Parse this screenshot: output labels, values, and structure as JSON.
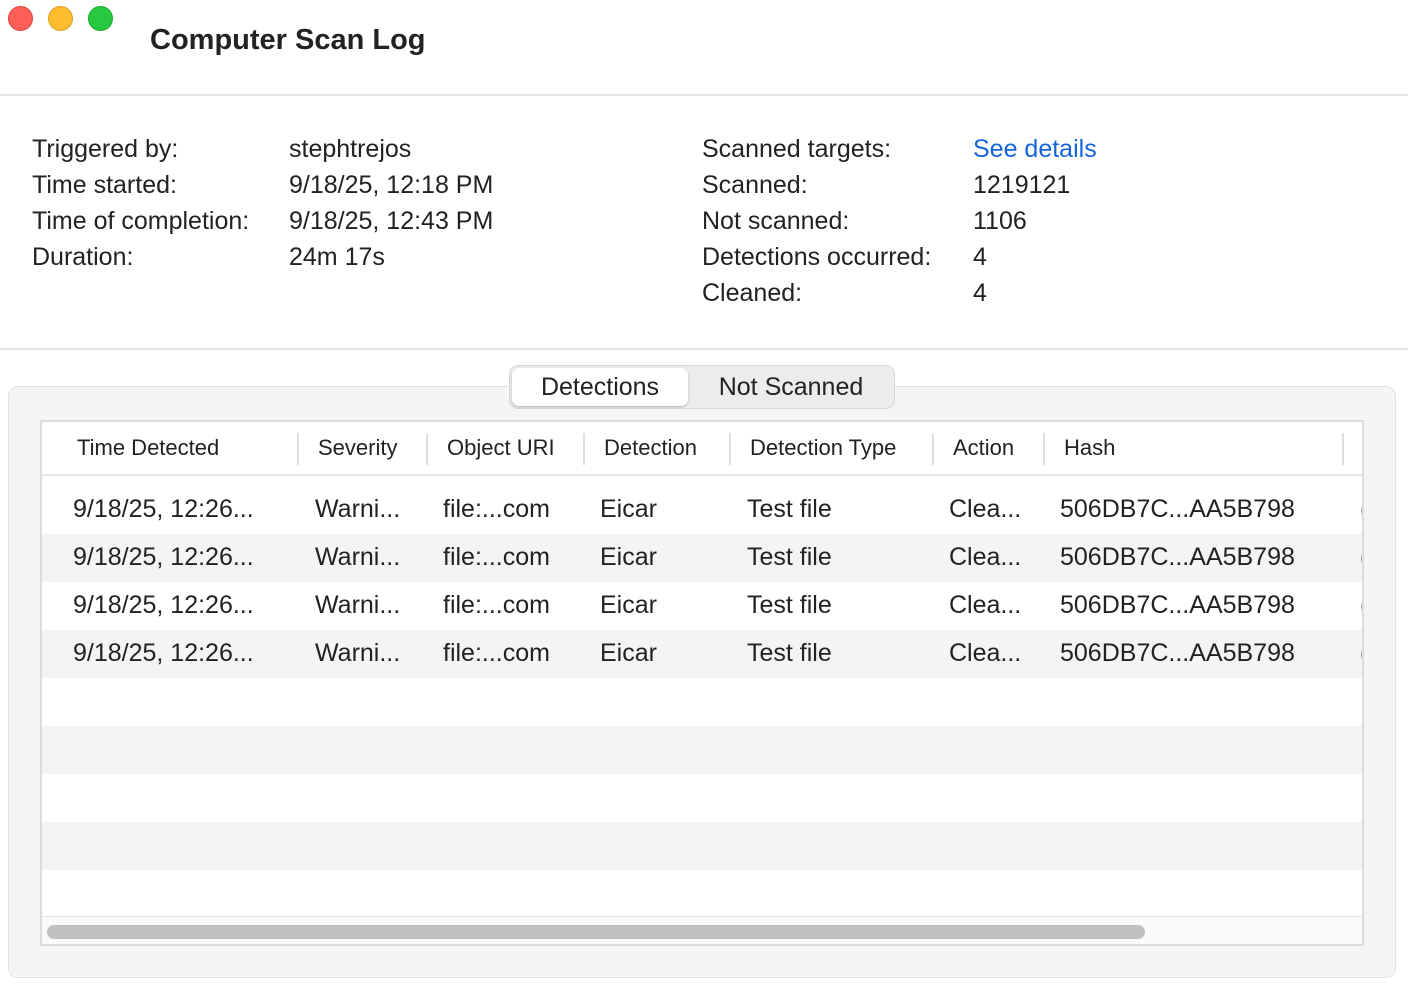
{
  "window": {
    "title": "Computer Scan Log"
  },
  "summary": {
    "left": [
      {
        "label": "Triggered by:",
        "value": "stephtrejos"
      },
      {
        "label": "Time started:",
        "value": "9/18/25, 12:18 PM"
      },
      {
        "label": "Time of completion:",
        "value": "9/18/25, 12:43 PM"
      },
      {
        "label": "Duration:",
        "value": "24m 17s"
      }
    ],
    "right": [
      {
        "label": "Scanned targets:",
        "value": "See details"
      },
      {
        "label": "Scanned:",
        "value": "1219121"
      },
      {
        "label": "Not scanned:",
        "value": "1106"
      },
      {
        "label": "Detections occurred:",
        "value": "4"
      },
      {
        "label": "Cleaned:",
        "value": "4"
      }
    ],
    "link_color": "#1565d8"
  },
  "tabs": [
    {
      "label": "Detections",
      "selected": true
    },
    {
      "label": "Not Scanned",
      "selected": false
    }
  ],
  "table": {
    "columns": [
      "Time Detected",
      "Severity",
      "Object URI",
      "Detection",
      "Detection Type",
      "Action",
      "Hash"
    ],
    "rows": [
      [
        "9/18/25, 12:26...",
        "Warni...",
        "file:...com",
        "Eicar",
        "Test file",
        "Clea...",
        "506DB7C...AA5B798"
      ],
      [
        "9/18/25, 12:26...",
        "Warni...",
        "file:...com",
        "Eicar",
        "Test file",
        "Clea...",
        "506DB7C...AA5B798"
      ],
      [
        "9/18/25, 12:26...",
        "Warni...",
        "file:...com",
        "Eicar",
        "Test file",
        "Clea...",
        "506DB7C...AA5B798"
      ],
      [
        "9/18/25, 12:26...",
        "Warni...",
        "file:...com",
        "Eicar",
        "Test file",
        "Clea...",
        "506DB7C...AA5B798"
      ]
    ],
    "truncated_column_glyph": "("
  }
}
